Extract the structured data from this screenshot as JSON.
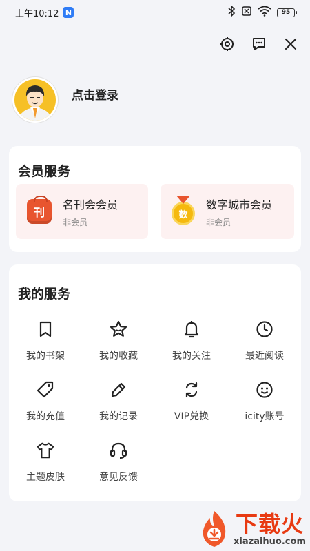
{
  "status_bar": {
    "time": "上午10:12",
    "n_badge": "N",
    "battery": "95"
  },
  "top_actions": {
    "icons": [
      "settings-icon",
      "message-icon",
      "close-icon"
    ]
  },
  "profile": {
    "login_text": "点击登录"
  },
  "membership": {
    "title": "会员服务",
    "items": [
      {
        "name": "名刊会会员",
        "status": "非会员",
        "icon_text": "刊"
      },
      {
        "name": "数字城市会员",
        "status": "非会员",
        "icon_text": "数"
      }
    ]
  },
  "services": {
    "title": "我的服务",
    "items": [
      {
        "label": "我的书架",
        "icon": "bookmark-icon"
      },
      {
        "label": "我的收藏",
        "icon": "star-icon"
      },
      {
        "label": "我的关注",
        "icon": "bell-icon"
      },
      {
        "label": "最近阅读",
        "icon": "clock-icon"
      },
      {
        "label": "我的充值",
        "icon": "tag-icon"
      },
      {
        "label": "我的记录",
        "icon": "pencil-icon"
      },
      {
        "label": "VIP兑换",
        "icon": "exchange-icon"
      },
      {
        "label": "icity账号",
        "icon": "smile-icon"
      },
      {
        "label": "主题皮肤",
        "icon": "shirt-icon"
      },
      {
        "label": "意见反馈",
        "icon": "headset-icon"
      }
    ]
  },
  "watermark": {
    "text": "下载火",
    "url": "xiazaihuo.com"
  },
  "colors": {
    "background": "#f3f4f8",
    "member_card_bg": "#fdf1f1",
    "magazine_icon": "#e8552f",
    "medal_icon": "#f5b90f",
    "watermark": "#e83a12"
  }
}
